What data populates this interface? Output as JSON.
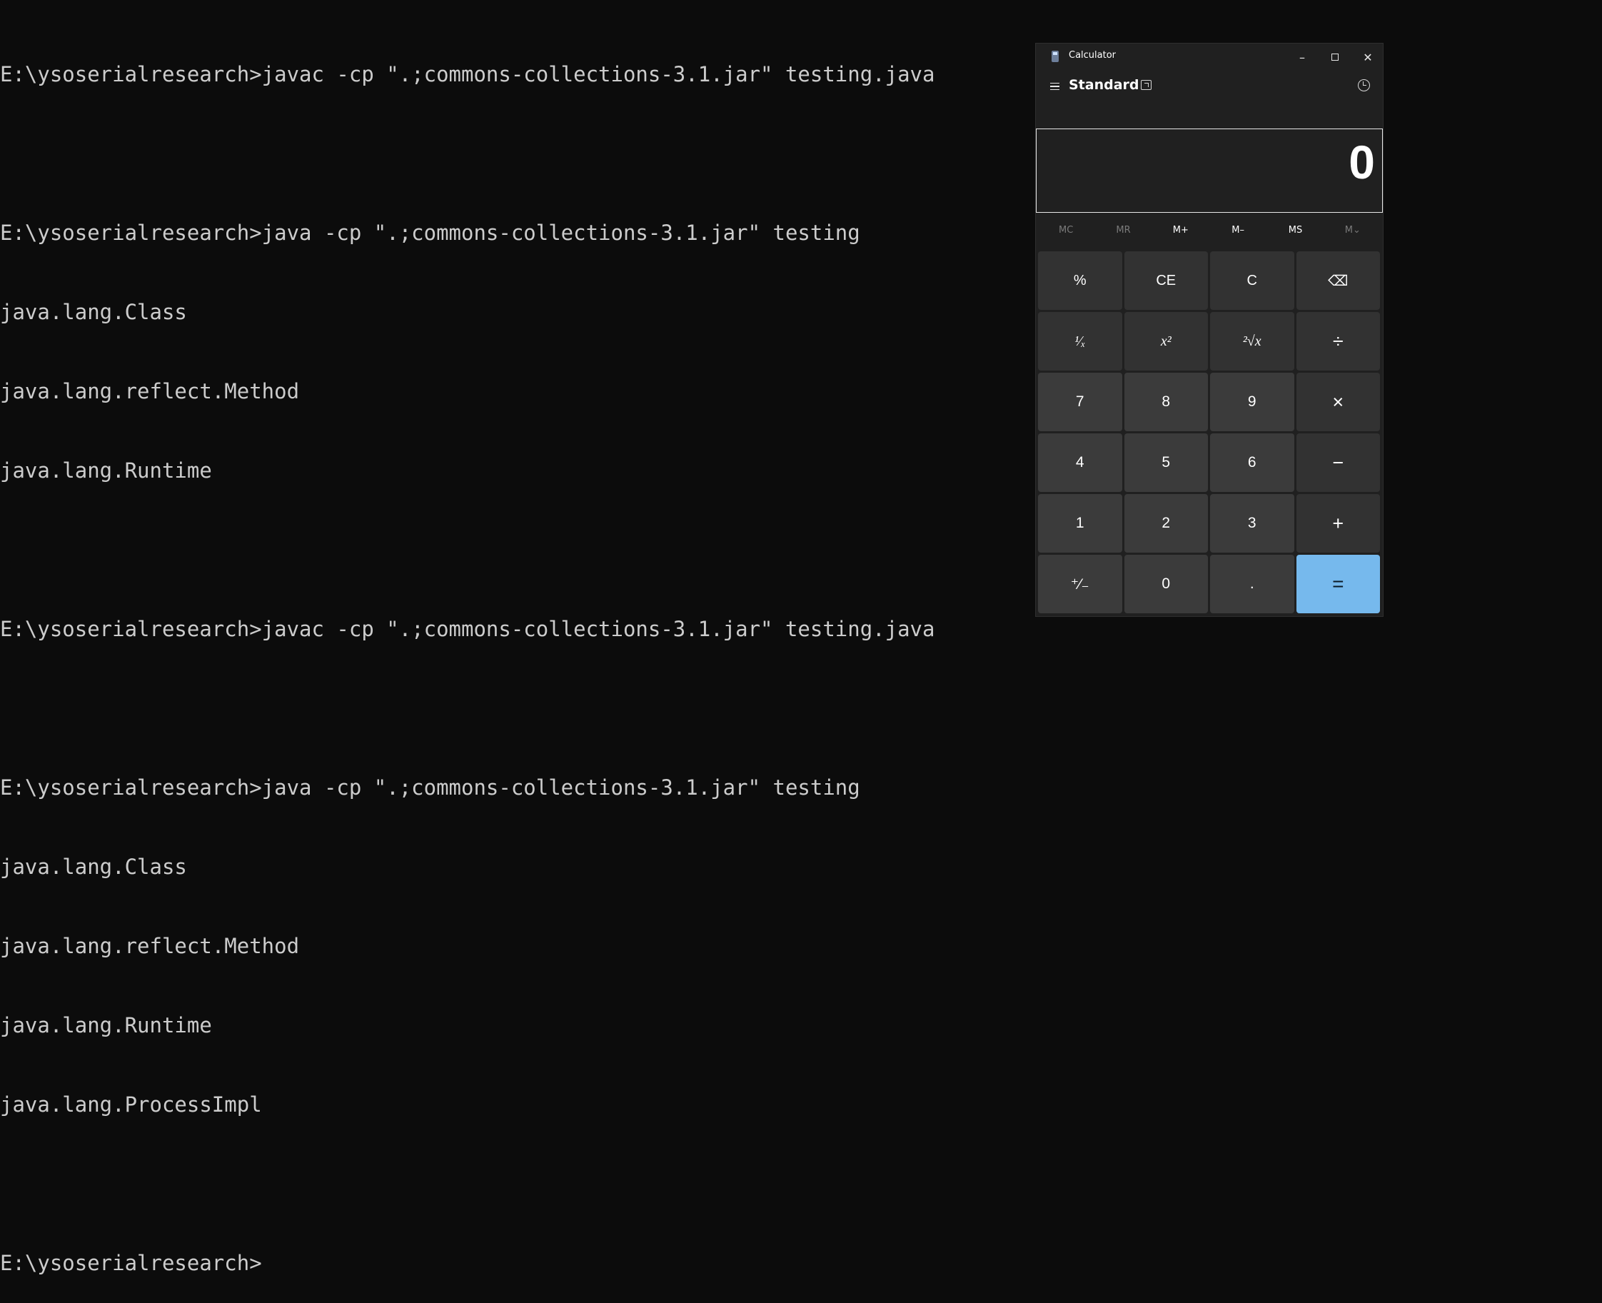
{
  "terminal": {
    "lines": [
      "E:\\ysoserialresearch>javac -cp \".;commons-collections-3.1.jar\" testing.java",
      "",
      "E:\\ysoserialresearch>java -cp \".;commons-collections-3.1.jar\" testing",
      "java.lang.Class",
      "java.lang.reflect.Method",
      "java.lang.Runtime",
      "",
      "E:\\ysoserialresearch>javac -cp \".;commons-collections-3.1.jar\" testing.java",
      "",
      "E:\\ysoserialresearch>java -cp \".;commons-collections-3.1.jar\" testing",
      "java.lang.Class",
      "java.lang.reflect.Method",
      "java.lang.Runtime",
      "java.lang.ProcessImpl",
      "",
      "E:\\ysoserialresearch>"
    ]
  },
  "calculator": {
    "title": "Calculator",
    "window_buttons": {
      "minimize": "–",
      "close": "✕"
    },
    "mode": "Standard",
    "display": "0",
    "memory": {
      "mc": "MC",
      "mr": "MR",
      "mplus": "M+",
      "mminus": "M–",
      "ms": "MS",
      "mlist": "M⌄"
    },
    "keys": {
      "percent": "%",
      "ce": "CE",
      "c": "C",
      "backspace": "⌫",
      "reciprocal": "¹⁄ₓ",
      "square": "x²",
      "sqrt": "²√x",
      "divide": "÷",
      "seven": "7",
      "eight": "8",
      "nine": "9",
      "multiply": "×",
      "four": "4",
      "five": "5",
      "six": "6",
      "minus": "−",
      "one": "1",
      "two": "2",
      "three": "3",
      "plus": "+",
      "negate": "⁺⁄₋",
      "zero": "0",
      "decimal": ".",
      "equals": "="
    },
    "colors": {
      "equals_accent": "#76b9ed",
      "window_bg": "#202020"
    }
  }
}
